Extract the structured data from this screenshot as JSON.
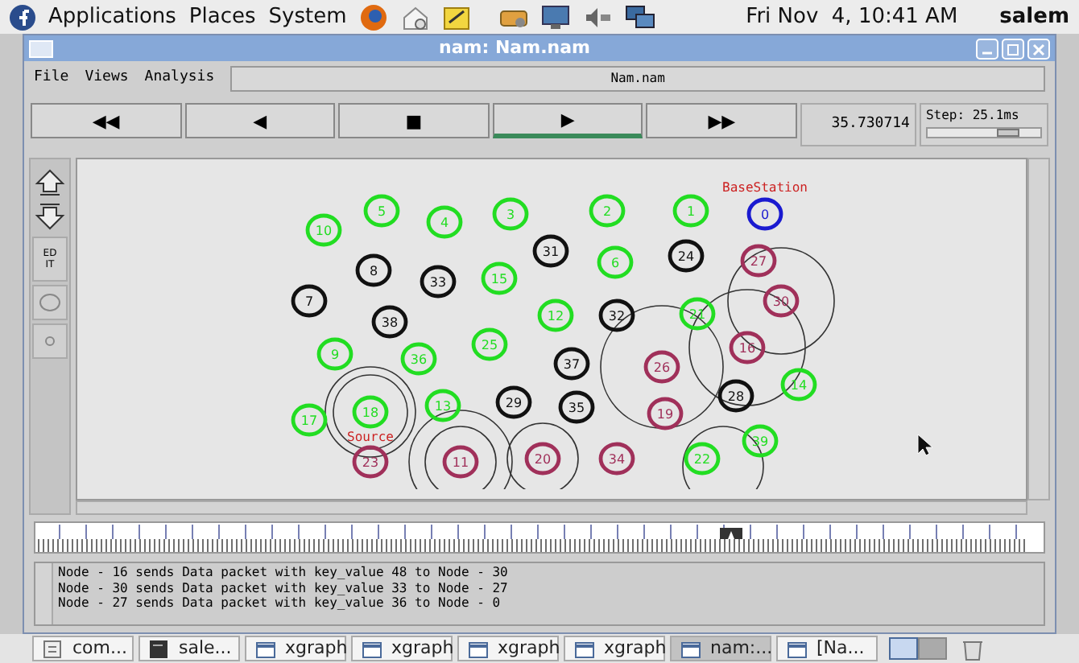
{
  "top_panel": {
    "menus": [
      "Applications",
      "Places",
      "System"
    ],
    "clock": "Fri Nov  4, 10:41 AM",
    "user": "salem"
  },
  "window": {
    "title": "nam: Nam.nam"
  },
  "menu_bar": {
    "items": [
      "File",
      "Views",
      "Analysis"
    ],
    "file_name": "Nam.nam"
  },
  "controls": {
    "buttons": [
      {
        "label": "◀◀",
        "selected": false
      },
      {
        "label": "◀",
        "selected": false
      },
      {
        "label": "■",
        "selected": false
      },
      {
        "label": "▶",
        "selected": true
      },
      {
        "label": "▶▶",
        "selected": false
      }
    ],
    "time": "35.730714",
    "step": {
      "label": "Step: 25.1ms",
      "level": 0.72
    }
  },
  "tools": [
    {
      "kind": "up"
    },
    {
      "kind": "down"
    },
    {
      "kind": "text",
      "label": "EDIT"
    },
    {
      "kind": "circle"
    },
    {
      "kind": "dot"
    }
  ],
  "canvas": {
    "labels": [
      "BaseStation",
      "Source"
    ],
    "nodes": [
      {
        "label": "10",
        "color": "#22dd22"
      },
      {
        "label": "5",
        "color": "#22dd22"
      },
      {
        "label": "4",
        "color": "#22dd22"
      },
      {
        "label": "3",
        "color": "#22dd22"
      },
      {
        "label": "2",
        "color": "#22dd22"
      },
      {
        "label": "1",
        "color": "#22dd22"
      },
      {
        "label": "0",
        "color": "#1a1ad0"
      },
      {
        "label": "8",
        "color": "#111111"
      },
      {
        "label": "33",
        "color": "#111111"
      },
      {
        "label": "15",
        "color": "#22dd22"
      },
      {
        "label": "31",
        "color": "#111111"
      },
      {
        "label": "6",
        "color": "#22dd22"
      },
      {
        "label": "24",
        "color": "#111111"
      },
      {
        "label": "27",
        "color": "#a0305a"
      },
      {
        "label": "7",
        "color": "#111111"
      },
      {
        "label": "38",
        "color": "#111111"
      },
      {
        "label": "12",
        "color": "#22dd22"
      },
      {
        "label": "32",
        "color": "#111111"
      },
      {
        "label": "21",
        "color": "#22dd22"
      },
      {
        "label": "30",
        "color": "#a0305a"
      },
      {
        "label": "9",
        "color": "#22dd22"
      },
      {
        "label": "36",
        "color": "#22dd22"
      },
      {
        "label": "25",
        "color": "#22dd22"
      },
      {
        "label": "37",
        "color": "#111111"
      },
      {
        "label": "26",
        "color": "#a0305a"
      },
      {
        "label": "16",
        "color": "#a0305a"
      },
      {
        "label": "17",
        "color": "#22dd22"
      },
      {
        "label": "18",
        "color": "#22dd22"
      },
      {
        "label": "13",
        "color": "#22dd22"
      },
      {
        "label": "29",
        "color": "#111111"
      },
      {
        "label": "35",
        "color": "#111111"
      },
      {
        "label": "19",
        "color": "#a0305a"
      },
      {
        "label": "28",
        "color": "#111111"
      },
      {
        "label": "14",
        "color": "#22dd22"
      },
      {
        "label": "23",
        "color": "#a0305a"
      },
      {
        "label": "11",
        "color": "#a0305a"
      },
      {
        "label": "20",
        "color": "#a0305a"
      },
      {
        "label": "34",
        "color": "#a0305a"
      },
      {
        "label": "22",
        "color": "#22dd22"
      },
      {
        "label": "39",
        "color": "#22dd22"
      }
    ]
  },
  "timeline": {
    "level": 0.69
  },
  "log": [
    "Node - 16 sends Data packet with key_value 48 to Node - 30",
    "Node - 30 sends Data packet with key_value 33 to Node - 27",
    "Node - 27 sends Data packet with key_value 36 to Node - 0"
  ],
  "taskbar": [
    {
      "label": "com...",
      "kind": "doc",
      "selected": false
    },
    {
      "label": "sale...",
      "kind": "terminal",
      "selected": false
    },
    {
      "label": "xgraph",
      "kind": "window",
      "selected": false
    },
    {
      "label": "xgraph",
      "kind": "window",
      "selected": false
    },
    {
      "label": "xgraph",
      "kind": "window",
      "selected": false
    },
    {
      "label": "xgraph",
      "kind": "window",
      "selected": false
    },
    {
      "label": "nam:...",
      "kind": "window",
      "selected": true
    },
    {
      "label": "[Na...",
      "kind": "window",
      "selected": false
    }
  ]
}
